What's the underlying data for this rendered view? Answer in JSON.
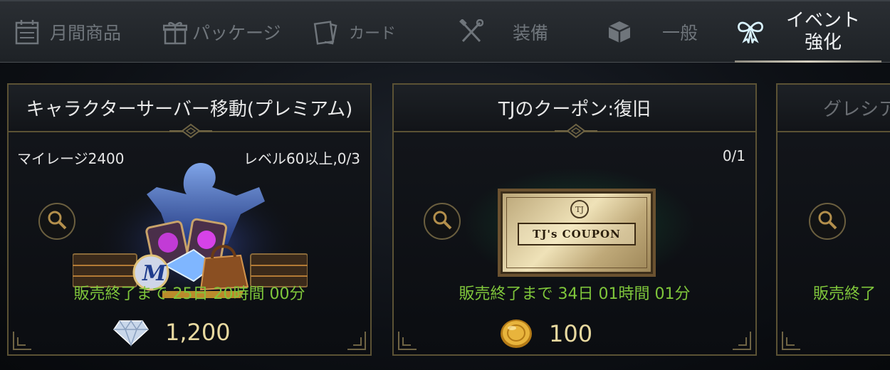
{
  "tabs": [
    {
      "label": "月間商品",
      "icon": "calendar-icon",
      "active": false
    },
    {
      "label": "パッケージ",
      "icon": "gift-icon",
      "active": false
    },
    {
      "label": "カード",
      "icon": "card-icon",
      "active": false
    },
    {
      "label": "装備",
      "icon": "crossed-tools-icon",
      "active": false
    },
    {
      "label": "一般",
      "icon": "box-icon",
      "active": false
    },
    {
      "label_line1": "イベント",
      "label_line2": "強化",
      "icon": "ribbon-icon",
      "active": true
    }
  ],
  "cards": [
    {
      "title": "キャラクターサーバー移動(プレミアム)",
      "meta_left": "マイレージ2400",
      "meta_right": "レベル60以上,0/3",
      "timer": "販売終了まで 25日 20時間 00分",
      "price": "1,200",
      "currency_icon": "diamond-gem-icon"
    },
    {
      "title": "TJのクーポン:復旧",
      "meta_left": "",
      "meta_right": "0/1",
      "coupon_text": "TJ's COUPON",
      "timer": "販売終了まで 34日 01時間 01分",
      "price": "100",
      "currency_icon": "gold-coin-icon"
    },
    {
      "title": "グレシア",
      "timer": "販売終了"
    }
  ],
  "colors": {
    "accent_gold": "#5b5234",
    "timer_green": "#7fc63b",
    "price_text": "#e8d9a0",
    "active_tab_text": "#f1f3f5",
    "inactive_tab_text": "#6f757b"
  }
}
